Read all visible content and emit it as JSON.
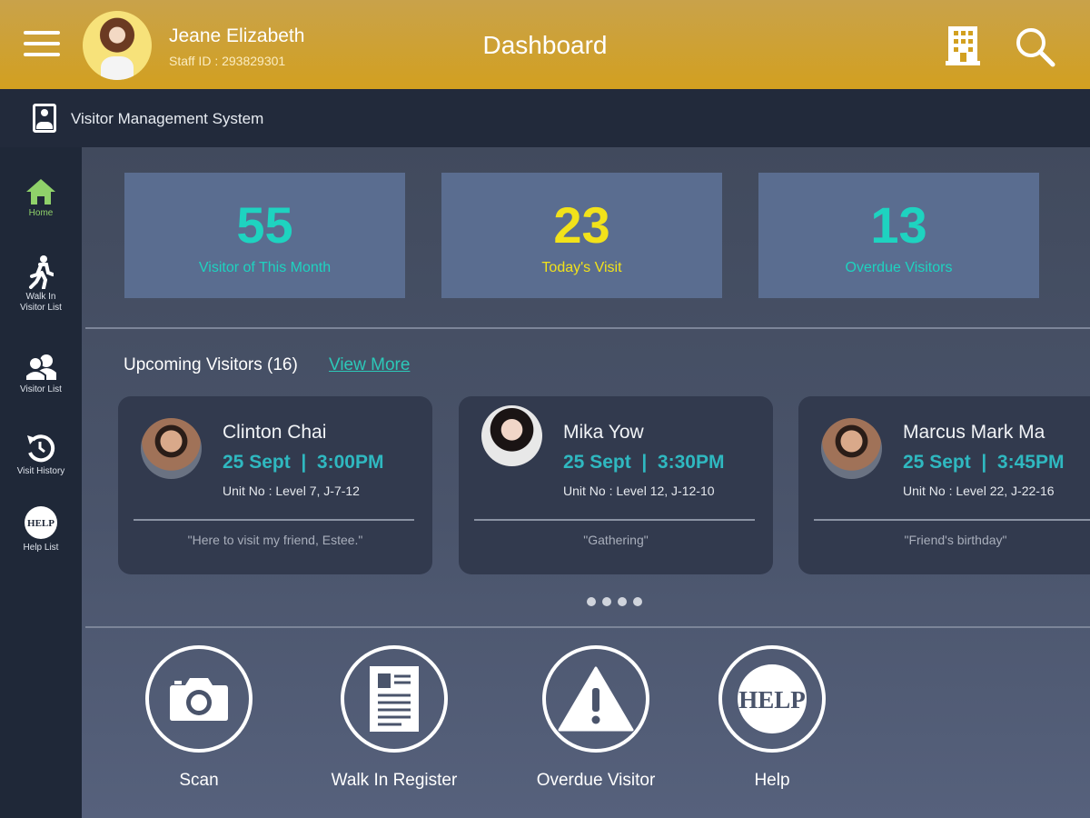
{
  "header": {
    "user_name": "Jeane Elizabeth",
    "staff_id": "Staff ID : 293829301",
    "title": "Dashboard"
  },
  "subheader": {
    "system_name": "Visitor Management System"
  },
  "sidebar": {
    "items": [
      {
        "label": "Home",
        "icon": "home-icon",
        "active": true
      },
      {
        "label": "Walk In\nVisitor List",
        "line1": "Walk In",
        "line2": "Visitor List",
        "icon": "walking-person-icon"
      },
      {
        "label": "Visitor List",
        "icon": "users-icon"
      },
      {
        "label": "Visit History",
        "icon": "history-icon"
      },
      {
        "label": "Help List",
        "icon": "help-icon"
      }
    ]
  },
  "stats": [
    {
      "value": "55",
      "label": "Visitor of This Month",
      "color": "#1ed3c0"
    },
    {
      "value": "23",
      "label": "Today's Visit",
      "color": "#f2e21a"
    },
    {
      "value": "13",
      "label": "Overdue Visitors",
      "color": "#1ed3c0"
    }
  ],
  "upcoming": {
    "title": "Upcoming Visitors (16)",
    "view_more": "View More",
    "page_count": 4,
    "visitors": [
      {
        "name": "Clinton Chai",
        "datetime": "25 Sept  |  3:00PM",
        "unit": "Unit No : Level 7, J-7-12",
        "note": "\"Here to visit my friend, Estee.\""
      },
      {
        "name": "Mika Yow",
        "datetime": "25 Sept  |  3:30PM",
        "unit": "Unit No : Level 12, J-12-10",
        "note": "\"Gathering\""
      },
      {
        "name": "Marcus Mark Ma",
        "datetime": "25 Sept  |  3:45PM",
        "unit": "Unit No : Level 22, J-22-16",
        "note": "\"Friend's birthday\""
      }
    ]
  },
  "actions": [
    {
      "label": "Scan",
      "icon": "camera-icon"
    },
    {
      "label": "Walk In Register",
      "icon": "form-icon"
    },
    {
      "label": "Overdue Visitor",
      "icon": "warning-icon"
    },
    {
      "label": "Help",
      "icon": "help-icon",
      "icon_text": "HELP"
    }
  ],
  "colors": {
    "header": "#d2a020",
    "accent": "#2cc8b8",
    "home_active": "#8fd16a"
  }
}
